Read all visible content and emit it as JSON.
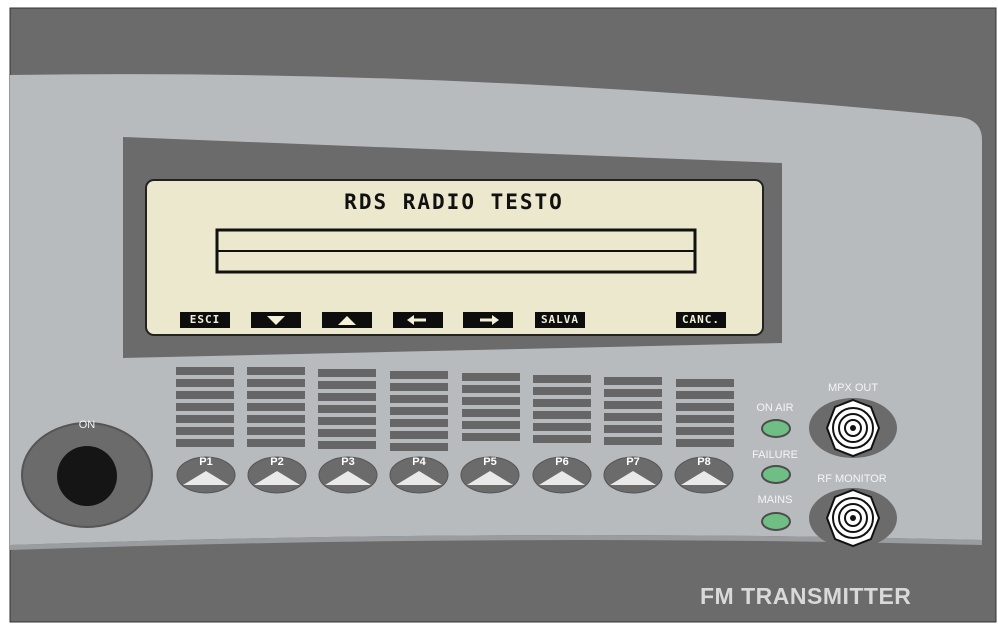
{
  "screen": {
    "title": "RDS RADIO TESTO",
    "input_value": ""
  },
  "softkeys": [
    {
      "label": "ESCI",
      "icon": ""
    },
    {
      "label": "",
      "icon": "arrow-down-icon"
    },
    {
      "label": "",
      "icon": "arrow-up-icon"
    },
    {
      "label": "",
      "icon": "arrow-left-icon"
    },
    {
      "label": "",
      "icon": "arrow-right-icon"
    },
    {
      "label": "SALVA",
      "icon": ""
    },
    {
      "label": "CANC.",
      "icon": ""
    }
  ],
  "presets": [
    "P1",
    "P2",
    "P3",
    "P4",
    "P5",
    "P6",
    "P7",
    "P8"
  ],
  "power": {
    "label": "ON"
  },
  "indicators": {
    "on_air": "ON AIR",
    "failure": "FAILURE",
    "mains": "MAINS"
  },
  "connectors": {
    "mpx_out": "MPX OUT",
    "rf_monitor": "RF MONITOR"
  },
  "brand": "FM TRANSMITTER",
  "colors": {
    "panel": "#b8bbbe",
    "dark_panel": "#6b6b6b",
    "lcd_bg": "#ece8cd",
    "led_green": "#6fbf84"
  }
}
